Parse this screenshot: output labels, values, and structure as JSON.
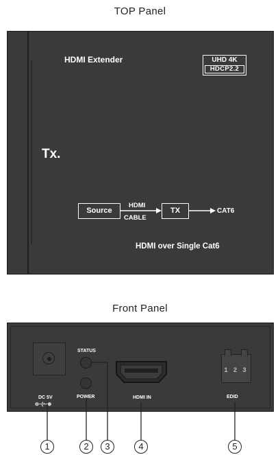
{
  "top_panel": {
    "title": "TOP Panel",
    "product_title": "HDMI Extender",
    "badge_line1": "UHD 4K",
    "badge_line2": "HDCP2.2",
    "unit_label": "Tx.",
    "diagram": {
      "source": "Source",
      "hdmi": "HDMI",
      "cable": "CABLE",
      "tx": "TX",
      "cat6": "CAT6"
    },
    "tagline": "HDMI over Single Cat6"
  },
  "front_panel": {
    "title": "Front Panel",
    "dc_label": "DC 5V",
    "dc_polarity": "⊖–(•–⊕",
    "status_label": "STATUS",
    "power_label": "POWER",
    "hdmi_label": "HDMI IN",
    "edid_numbers": "1 2 3",
    "edid_label": "EDID"
  },
  "callouts": [
    "1",
    "2",
    "3",
    "4",
    "5"
  ]
}
